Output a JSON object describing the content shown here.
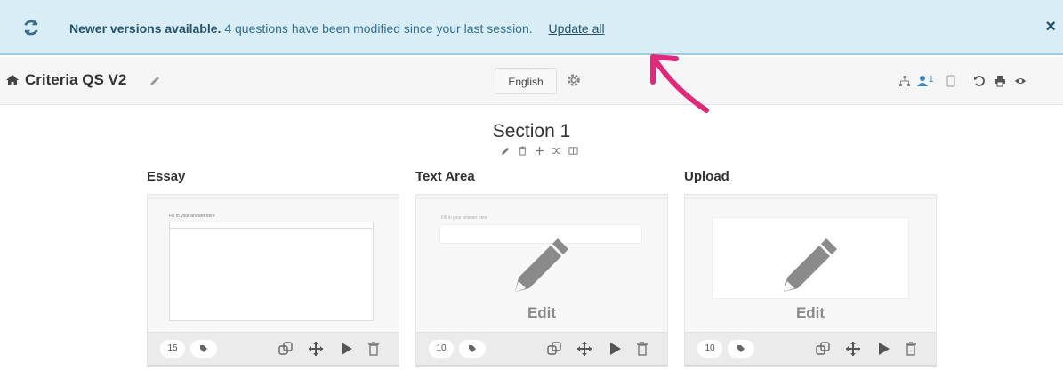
{
  "banner": {
    "title": "Newer versions available.",
    "message": "4 questions have been modified since your last session.",
    "link": "Update all",
    "close": "×",
    "icon": "refresh-icon",
    "bg_color": "#d9edf7"
  },
  "toolbar": {
    "title": "Criteria QS V2",
    "language": "English",
    "user_count": "1",
    "icons": [
      "home-icon",
      "pencil-icon",
      "gear-icon",
      "hierarchy-icon",
      "user-icon",
      "mobile-icon",
      "history-icon",
      "print-icon",
      "preview-eye-icon"
    ]
  },
  "section": {
    "title": "Section 1",
    "tools": [
      "pencil-icon",
      "trash-icon",
      "move-icon",
      "shuffle-icon",
      "columns-icon"
    ]
  },
  "questions": [
    {
      "label": "Essay",
      "points": "15",
      "preview_title": "Fill in your answer here"
    },
    {
      "label": "Text Area",
      "points": "10",
      "edit_label": "Edit",
      "preview_title": "Fill in your answer here"
    },
    {
      "label": "Upload",
      "points": "10",
      "edit_label": "Edit"
    }
  ],
  "colors": {
    "accent": "#31708f",
    "annotation": "#e0297a"
  }
}
